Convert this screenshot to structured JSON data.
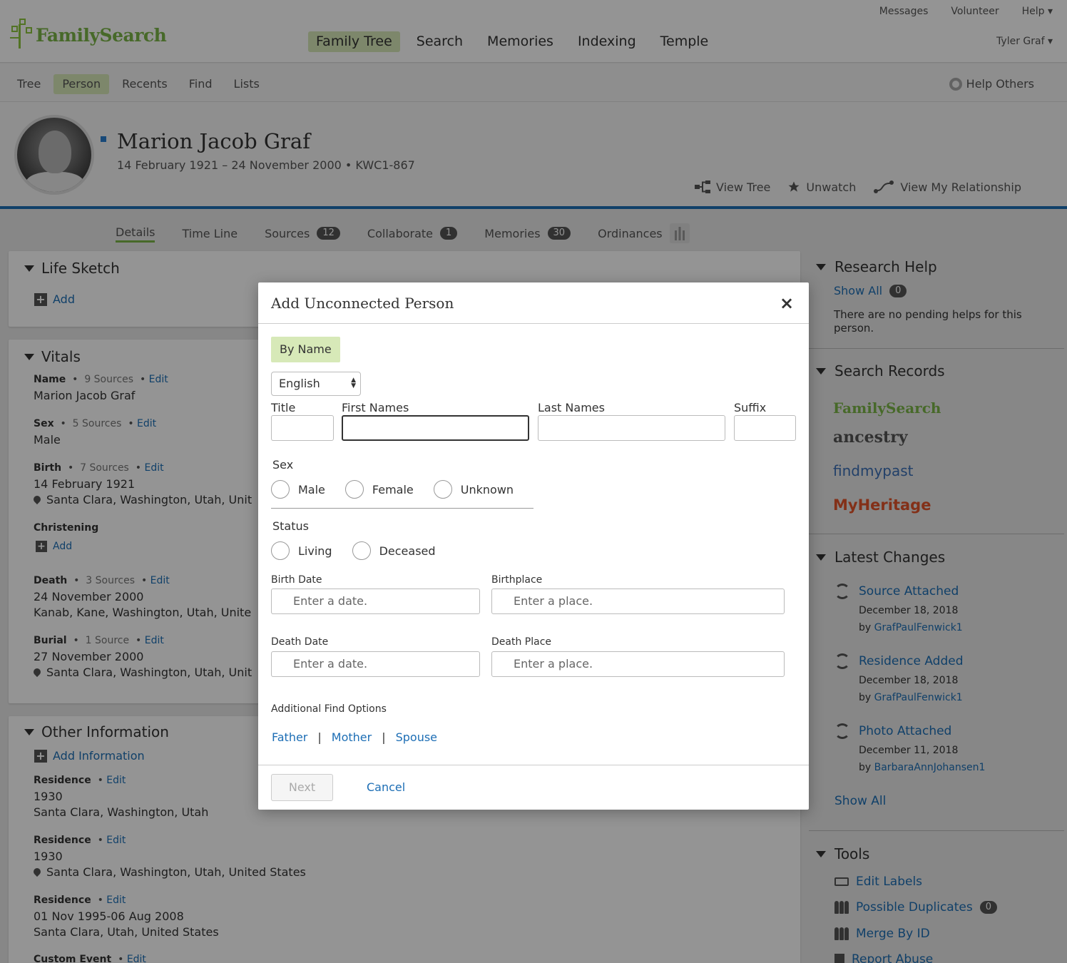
{
  "header": {
    "logo_text": "FamilySearch",
    "util_nav": [
      "Messages",
      "Volunteer",
      "Help ▾"
    ],
    "main_nav": [
      "Family Tree",
      "Search",
      "Memories",
      "Indexing",
      "Temple"
    ],
    "user": "Tyler Graf ▾"
  },
  "subnav": {
    "tabs": [
      "Tree",
      "Person",
      "Recents",
      "Find",
      "Lists"
    ],
    "help_others": "Help Others"
  },
  "person": {
    "name": "Marion Jacob Graf",
    "meta": "14 February 1921 – 24 November 2000 • KWC1-867",
    "actions": [
      "View Tree",
      "Unwatch",
      "View My Relationship"
    ]
  },
  "detail_tabs": [
    {
      "label": "Details",
      "count": ""
    },
    {
      "label": "Time Line",
      "count": ""
    },
    {
      "label": "Sources",
      "count": "12"
    },
    {
      "label": "Collaborate",
      "count": "1"
    },
    {
      "label": "Memories",
      "count": "30"
    },
    {
      "label": "Ordinances",
      "count": ""
    }
  ],
  "life_sketch": {
    "title": "Life Sketch",
    "add": "Add"
  },
  "vitals": {
    "title": "Vitals",
    "name_label": "Name",
    "name_sources": "9 Sources",
    "name_value": "Marion Jacob Graf",
    "sex_label": "Sex",
    "sex_sources": "5 Sources",
    "sex_value": "Male",
    "birth_label": "Birth",
    "birth_sources": "7 Sources",
    "birth_date": "14 February 1921",
    "birth_place": "Santa Clara, Washington, Utah, Unit",
    "christening_label": "Christening",
    "christening_add": "Add",
    "death_label": "Death",
    "death_sources": "3 Sources",
    "death_date": "24 November 2000",
    "death_place": "Kanab, Kane, Washington, Utah, Unite",
    "burial_label": "Burial",
    "burial_sources": "1 Source",
    "burial_date": "27 November 2000",
    "burial_place": "Santa Clara, Washington, Utah, Unit",
    "edit": "Edit"
  },
  "other_info": {
    "title": "Other Information",
    "add": "Add Information",
    "res_label": "Residence",
    "res1_date": "1930",
    "res1_place": "Santa Clara, Washington, Utah",
    "res2_date": "1930",
    "res2_place": "Santa Clara, Washington, Utah, United States",
    "res3_date": "01 Nov 1995-06 Aug 2008",
    "res3_place": "Santa Clara, Utah, United States",
    "custom_label": "Custom Event"
  },
  "research_help": {
    "title": "Research Help",
    "show_all": "Show All",
    "count": "0",
    "empty": "There are no pending helps for this person."
  },
  "search_records": {
    "title": "Search Records",
    "partners": [
      "FamilySearch",
      "ancestry",
      "findmypast",
      "MyHeritage"
    ]
  },
  "latest_changes": {
    "title": "Latest Changes",
    "items": [
      {
        "title": "Source Attached",
        "date": "December 18, 2018",
        "by": "by",
        "user": "GrafPaulFenwick1"
      },
      {
        "title": "Residence Added",
        "date": "December 18, 2018",
        "by": "by",
        "user": "GrafPaulFenwick1"
      },
      {
        "title": "Photo Attached",
        "date": "December 11, 2018",
        "by": "by",
        "user": "BarbaraAnnJohansen1"
      }
    ],
    "show_all": "Show All"
  },
  "tools": {
    "title": "Tools",
    "items": [
      "Edit Labels",
      "Possible Duplicates",
      "Merge By ID",
      "Report Abuse"
    ],
    "dup_count": "0"
  },
  "modal": {
    "title": "Add Unconnected Person",
    "close": "×",
    "tab": "By Name",
    "language": "English",
    "title_label": "Title",
    "first_label": "First Names",
    "last_label": "Last Names",
    "suffix_label": "Suffix",
    "sex_label": "Sex",
    "sex_options": [
      "Male",
      "Female",
      "Unknown"
    ],
    "status_label": "Status",
    "status_options": [
      "Living",
      "Deceased"
    ],
    "birth_date_label": "Birth Date",
    "birth_date_placeholder": "Enter a date.",
    "birthplace_label": "Birthplace",
    "birthplace_placeholder": "Enter a place.",
    "death_date_label": "Death Date",
    "death_date_placeholder": "Enter a date.",
    "death_place_label": "Death Place",
    "death_place_placeholder": "Enter a place.",
    "additional_label": "Additional Find Options",
    "find_options": [
      "Father",
      "Mother",
      "Spouse"
    ],
    "next": "Next",
    "cancel": "Cancel"
  },
  "colors": {
    "accent_green": "#d7e9b8",
    "link_blue": "#1d6eb5",
    "brand_green": "#7ab648"
  }
}
